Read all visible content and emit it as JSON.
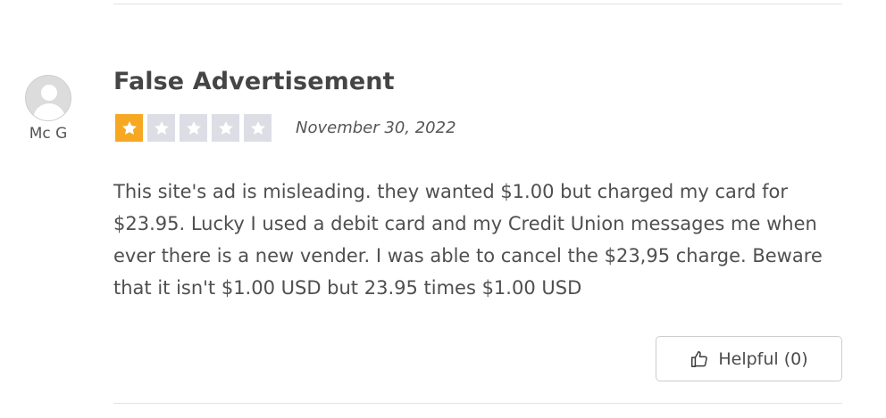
{
  "review": {
    "author": "Mc G",
    "title": "False Advertisement",
    "rating": 1,
    "max_rating": 5,
    "date": "November 30, 2022",
    "body": "This site's ad is misleading. they wanted $1.00 but charged my card for $23.95. Lucky I used a debit card and my Credit Union messages me when ever there is a new vender. I was able to cancel the $23,95 charge. Beware that it isn't $1.00 USD but 23.95 times $1.00 USD",
    "helpful_label": "Helpful (0)"
  },
  "icons": {
    "avatar": "user-avatar-icon",
    "star": "star-icon",
    "helpful": "thumbs-up-icon"
  },
  "colors": {
    "star_filled": "#f7a823",
    "star_empty": "#dddde6"
  }
}
